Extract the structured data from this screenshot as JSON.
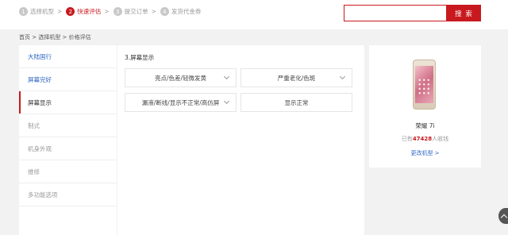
{
  "steps": [
    {
      "num": "1",
      "label": "选择机型",
      "arrow": ">"
    },
    {
      "num": "2",
      "label": "快速评估",
      "arrow": ">"
    },
    {
      "num": "3",
      "label": "提交订单",
      "arrow": ">"
    },
    {
      "num": "4",
      "label": "发货代金券",
      "arrow": ""
    }
  ],
  "search": {
    "value": "",
    "button_label": "搜 索"
  },
  "breadcrumb": "首页 > 选择机型 > 价格评估",
  "sidebar": {
    "items": [
      {
        "label": "大陆国行",
        "state": "done"
      },
      {
        "label": "屏幕完好",
        "state": "done"
      },
      {
        "label": "屏幕显示",
        "state": "current"
      },
      {
        "label": "制式",
        "state": "pending"
      },
      {
        "label": "机身外观",
        "state": "pending"
      },
      {
        "label": "维修",
        "state": "pending"
      },
      {
        "label": "多功能选项",
        "state": "pending"
      }
    ]
  },
  "main": {
    "section_title": "3.屏幕显示",
    "options": [
      {
        "label": "亮点/色差/轻微发黄",
        "has_dropdown": true
      },
      {
        "label": "严重老化/色斑",
        "has_dropdown": true
      },
      {
        "label": "漏液/断线/显示不正常/高仿屏",
        "has_dropdown": true
      },
      {
        "label": "显示正常",
        "has_dropdown": false
      }
    ]
  },
  "card": {
    "model_name": "荣耀 7i",
    "sold_prefix": "已有",
    "sold_count": "47428",
    "sold_suffix": "人收钱",
    "change_link": "更改机型 >"
  },
  "icons": {
    "phone_image": "phone-image-icon",
    "chevron": "chevron-down-icon",
    "scroll_top": "scroll-top-icon"
  },
  "colors": {
    "accent": "#c8191f",
    "link": "#2e64c4"
  }
}
